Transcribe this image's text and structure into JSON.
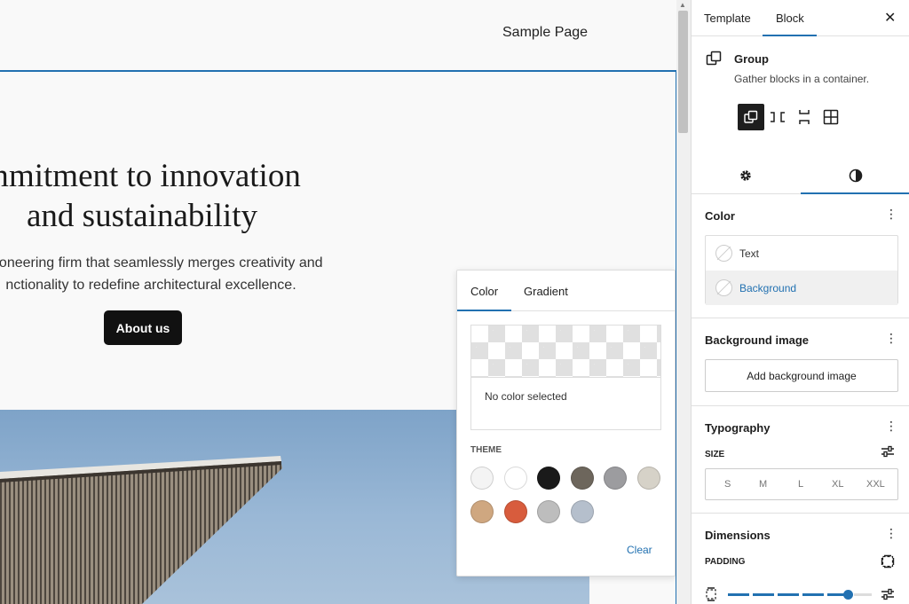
{
  "canvas": {
    "nav_link": "Sample Page",
    "hero": {
      "title_line1": "mmitment to innovation",
      "title_line2": "and sustainability",
      "text_line1": "pioneering firm that seamlessly merges creativity and",
      "text_line2": "nctionality to redefine architectural excellence.",
      "button_label": "About us"
    }
  },
  "color_popover": {
    "tabs": [
      {
        "label": "Color",
        "active": true
      },
      {
        "label": "Gradient",
        "active": false
      }
    ],
    "preview_text": "No color selected",
    "palette_label": "THEME",
    "palette_colors": [
      "#f4f4f4",
      "#ffffff",
      "#1a1a1a",
      "#6d665c",
      "#9c9c9f",
      "#d6d2c8",
      "#cfa780",
      "#d85c3d",
      "#bdbdbd",
      "#b5bfcc"
    ],
    "clear_label": "Clear"
  },
  "sidebar": {
    "tabs": [
      {
        "label": "Template",
        "active": false
      },
      {
        "label": "Block",
        "active": true
      }
    ],
    "close_icon": "close-icon",
    "block": {
      "name": "Group",
      "description": "Gather blocks in a container.",
      "variations": [
        "group-icon",
        "row-icon",
        "stack-icon",
        "grid-icon"
      ]
    },
    "inspector_tabs": [
      "settings-icon",
      "styles-icon"
    ],
    "color_panel": {
      "title": "Color",
      "items": [
        {
          "label": "Text",
          "selected": false
        },
        {
          "label": "Background",
          "selected": true
        }
      ]
    },
    "background_image_panel": {
      "title": "Background image",
      "button_label": "Add background image"
    },
    "typography_panel": {
      "title": "Typography",
      "size_label": "SIZE",
      "sizes": [
        "S",
        "M",
        "L",
        "XL",
        "XXL"
      ]
    },
    "dimensions_panel": {
      "title": "Dimensions",
      "padding_label": "PADDING"
    },
    "accent_color": "#2271b1"
  }
}
